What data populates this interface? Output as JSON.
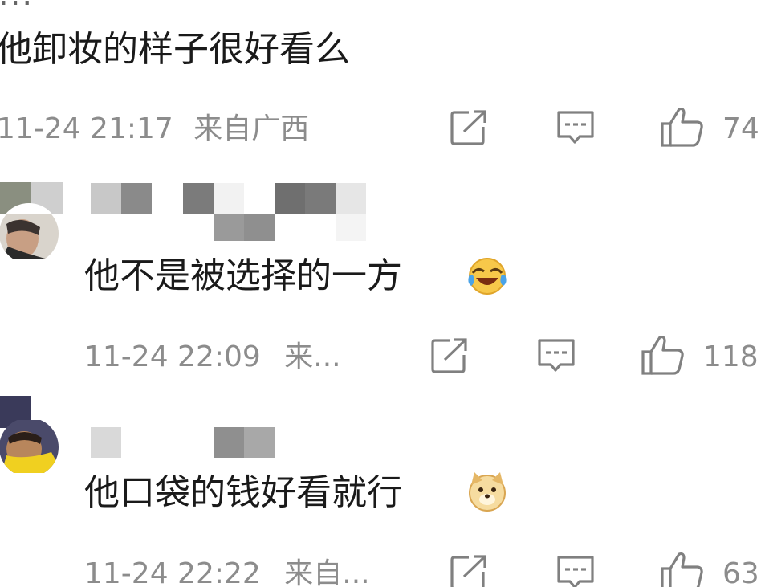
{
  "top_comment": {
    "cut_username": "...",
    "text": "他卸妆的样子很好看么",
    "date": "11-24 21:17",
    "location": "来自广西",
    "like_count": "74"
  },
  "replies": [
    {
      "text": "他不是被选择的一方",
      "emoji": "laugh-cry-emoji",
      "date": "11-24 22:09",
      "location": "来...",
      "like_count": "118"
    },
    {
      "text": "他口袋的钱好看就行",
      "emoji": "doge-emoji",
      "date": "11-24 22:22",
      "location": "来自...",
      "like_count": "63"
    }
  ],
  "icons": {
    "share": "share-icon",
    "comment": "comment-icon",
    "like": "thumbs-up-icon"
  },
  "colors": {
    "text": "#1a1a1a",
    "meta": "#8c8c8c",
    "icon": "#808080"
  }
}
